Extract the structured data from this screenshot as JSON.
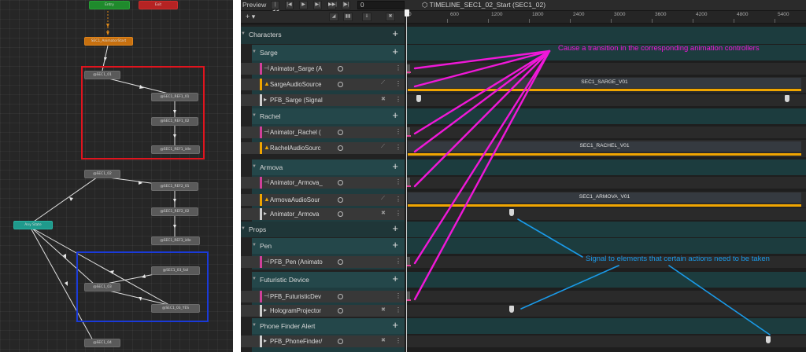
{
  "animator": {
    "states": {
      "entry": "Entry",
      "exit": "Exit",
      "default_state": "SEC1_AnimatorStart",
      "any_state": "Any State",
      "sarge_1": "@SEC1_01",
      "sarge_2": "@SEC1_REF1_01",
      "sarge_3": "@SEC1_REF1_02",
      "sarge_4": "@SEC1_REF1_idle",
      "rachel_1": "@SEC1_02",
      "rachel_2": "@SEC1_REF2_01",
      "rachel_3": "@SEC1_REF2_02",
      "rachel_4": "@SEC1_REF3_idle",
      "armova_1": "@SEC1_03_fail",
      "armova_2": "@SEC1_03",
      "armova_3": "@SEC1_03_YES",
      "bottom": "@SEC1_04"
    },
    "colors": {
      "red_box": "#e0141e",
      "blue_box": "#1a3ad8"
    }
  },
  "timeline": {
    "preview_label": "Preview",
    "frame_value": "0",
    "asset_title": "TIMELINE_SEC1_02_Start (SEC1_02)",
    "add_menu": "+ ▾",
    "ruler_ticks": [
      "0",
      "600",
      "1200",
      "1800",
      "2400",
      "3000",
      "3600",
      "4200",
      "4800",
      "5400"
    ],
    "groups": {
      "characters": "Characters",
      "sarge": "Sarge",
      "rachel": "Rachel",
      "armova": "Armova",
      "props": "Props",
      "pen": "Pen",
      "device": "Futuristic Device",
      "phone": "Phone Finder Alert"
    },
    "tracks": {
      "sarge_anim": "Animator_Sarge (A",
      "sarge_audio": "SargeAudioSource",
      "sarge_signal": "PFB_Sarge (Signal",
      "rachel_anim": "Animator_Rachel (",
      "rachel_audio": "RachelAudioSourc",
      "armova_anim": "Animator_Armova_",
      "armova_audio": "ArmovaAudioSour",
      "armova_signal": "Animator_Armova",
      "pen_anim": "PFB_Pen (Animato",
      "device_anim": "PFB_FuturisticDev",
      "device_signal": "HologramProjector",
      "phone_signal": "PFB_PhoneFinder/"
    },
    "clips": {
      "sarge": "SEC1_SARGE_V01",
      "rachel": "SEC1_RACHEL_V01",
      "armova": "SEC1_ARMOVA_V01"
    },
    "colors": {
      "audio_stripe": "#f0a500",
      "anim_stripe": "#d0409a",
      "signal_stripe": "#cfcfcf"
    }
  },
  "annotations": {
    "transition": "Cause a transition in the corresponding animation controllers",
    "signal": "Signal to elements that certain actions need to be taken",
    "colors": {
      "magenta": "#f018d8",
      "blue": "#1a9ae8"
    }
  }
}
